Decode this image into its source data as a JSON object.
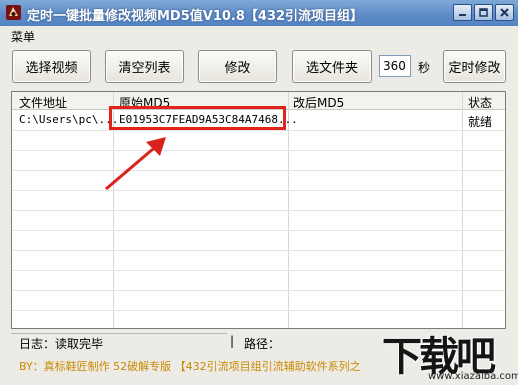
{
  "window": {
    "title": "定时一键批量修改视频MD5值V10.8【432引流项目组】"
  },
  "menubar": {
    "menu_label": "菜单"
  },
  "toolbar": {
    "select_video": "选择视频",
    "clear_list": "清空列表",
    "modify": "修改",
    "select_folder": "选文件夹",
    "seconds_value": "360",
    "seconds_unit": "秒",
    "timed_modify": "定时修改"
  },
  "table": {
    "columns": [
      "文件地址",
      "原始MD5",
      "改后MD5",
      "状态"
    ],
    "rows": [
      {
        "path": "C:\\Users\\pc\\...",
        "orig_md5": "E01953C7FEAD9A53C84A7468...",
        "new_md5": "",
        "status": "就绪"
      }
    ]
  },
  "status": {
    "log": "日志：读取完毕",
    "separator": "|",
    "path_label": "路径："
  },
  "footer": {
    "text": "BY：真标鞋匠制作 52破解专版 【432引流项目组引流辅助软件系列之"
  },
  "watermark": {
    "brand": "下载吧",
    "url": "www.xiazaiba.com"
  },
  "colors": {
    "highlight": "#e3231b",
    "titlebar": "#5c8ac7",
    "footer_text": "#c98a00"
  }
}
